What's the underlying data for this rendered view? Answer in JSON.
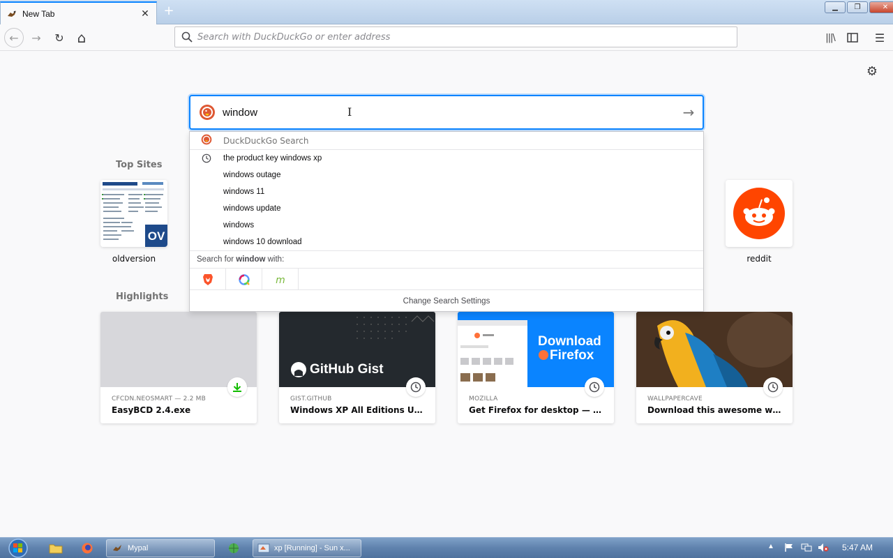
{
  "browser": {
    "tab_title": "New Tab",
    "tab_close": "✕",
    "new_tab": "+",
    "url_placeholder": "Search with DuckDuckGo or enter address"
  },
  "window_controls": {
    "minimize": "▁",
    "restore": "❐",
    "close": "✕"
  },
  "nav": {
    "back": "←",
    "forward": "→",
    "reload": "↻",
    "home": "⌂",
    "library": "|||\\",
    "sidebar": "▯",
    "menu": "☰"
  },
  "newtab": {
    "settings_icon": "⚙",
    "top_sites_title": "Top Sites",
    "highlights_title": "Highlights",
    "top_sites": [
      {
        "label": "oldversion"
      },
      {
        "label": "reddit"
      }
    ],
    "highlights": [
      {
        "source": "CFCDN.NEOSMART — 2.2 MB",
        "title": "EasyBCD 2.4.exe",
        "badge": "download-icon"
      },
      {
        "source": "GIST.GITHUB",
        "title": "Windows XP All Editions Univers...",
        "badge": "clock-icon",
        "image_text": "GitHub Gist"
      },
      {
        "source": "MOZILLA",
        "title": "Get Firefox for desktop — Mozil...",
        "badge": "clock-icon",
        "image_text_1": "Download",
        "image_text_2": "Firefox"
      },
      {
        "source": "WALLPAPERCAVE",
        "title": "Download this awesome wallpap...",
        "badge": "clock-icon"
      }
    ]
  },
  "search": {
    "value": "window",
    "submit": "→",
    "header_label": "DuckDuckGo Search",
    "suggestions": [
      {
        "text": "the product key windows xp",
        "history": true
      },
      {
        "text": "windows outage",
        "history": false
      },
      {
        "text": "windows 11",
        "history": false
      },
      {
        "text": "windows update",
        "history": false
      },
      {
        "text": "windows",
        "history": false
      },
      {
        "text": "windows 10 download",
        "history": false
      }
    ],
    "search_for_prefix": "Search for ",
    "search_for_term": "window",
    "search_for_suffix": " with:",
    "change_settings": "Change Search Settings"
  },
  "taskbar": {
    "mypal": "Mypal",
    "vbox": "xp [Running] - Sun x...",
    "clock": "5:47 AM"
  },
  "colors": {
    "accent": "#0a84ff",
    "reddit": "#ff4500",
    "firefox_banner": "#0a84ff",
    "github_bg": "#24292e"
  }
}
